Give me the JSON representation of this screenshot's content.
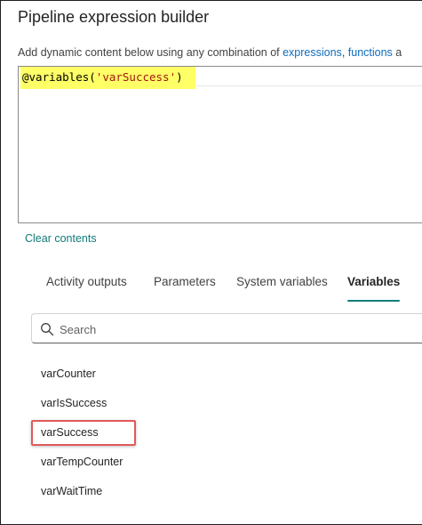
{
  "dialog": {
    "title": "Pipeline expression builder",
    "description_prefix": "Add dynamic content below using any combination of ",
    "description_link1": "expressions",
    "description_sep": ", ",
    "description_link2": "functions",
    "description_tail": " a"
  },
  "editor": {
    "code_prefix": "@variables(",
    "code_string": "'varSuccess'",
    "code_suffix": ")",
    "highlight_color": "#ffff66"
  },
  "clear_contents": "Clear contents",
  "tabs": [
    {
      "label": "Activity outputs",
      "active": false
    },
    {
      "label": "Parameters",
      "active": false
    },
    {
      "label": "System variables",
      "active": false
    },
    {
      "label": "Variables",
      "active": true
    }
  ],
  "search": {
    "placeholder": "Search",
    "value": "",
    "icon": "search-icon"
  },
  "variables": [
    {
      "name": "varCounter"
    },
    {
      "name": "varIsSuccess"
    },
    {
      "name": "varSuccess",
      "highlighted": true
    },
    {
      "name": "varTempCounter"
    },
    {
      "name": "varWaitTime"
    }
  ],
  "colors": {
    "accent": "#0f7b7a",
    "highlight_border": "#e05a5a"
  }
}
